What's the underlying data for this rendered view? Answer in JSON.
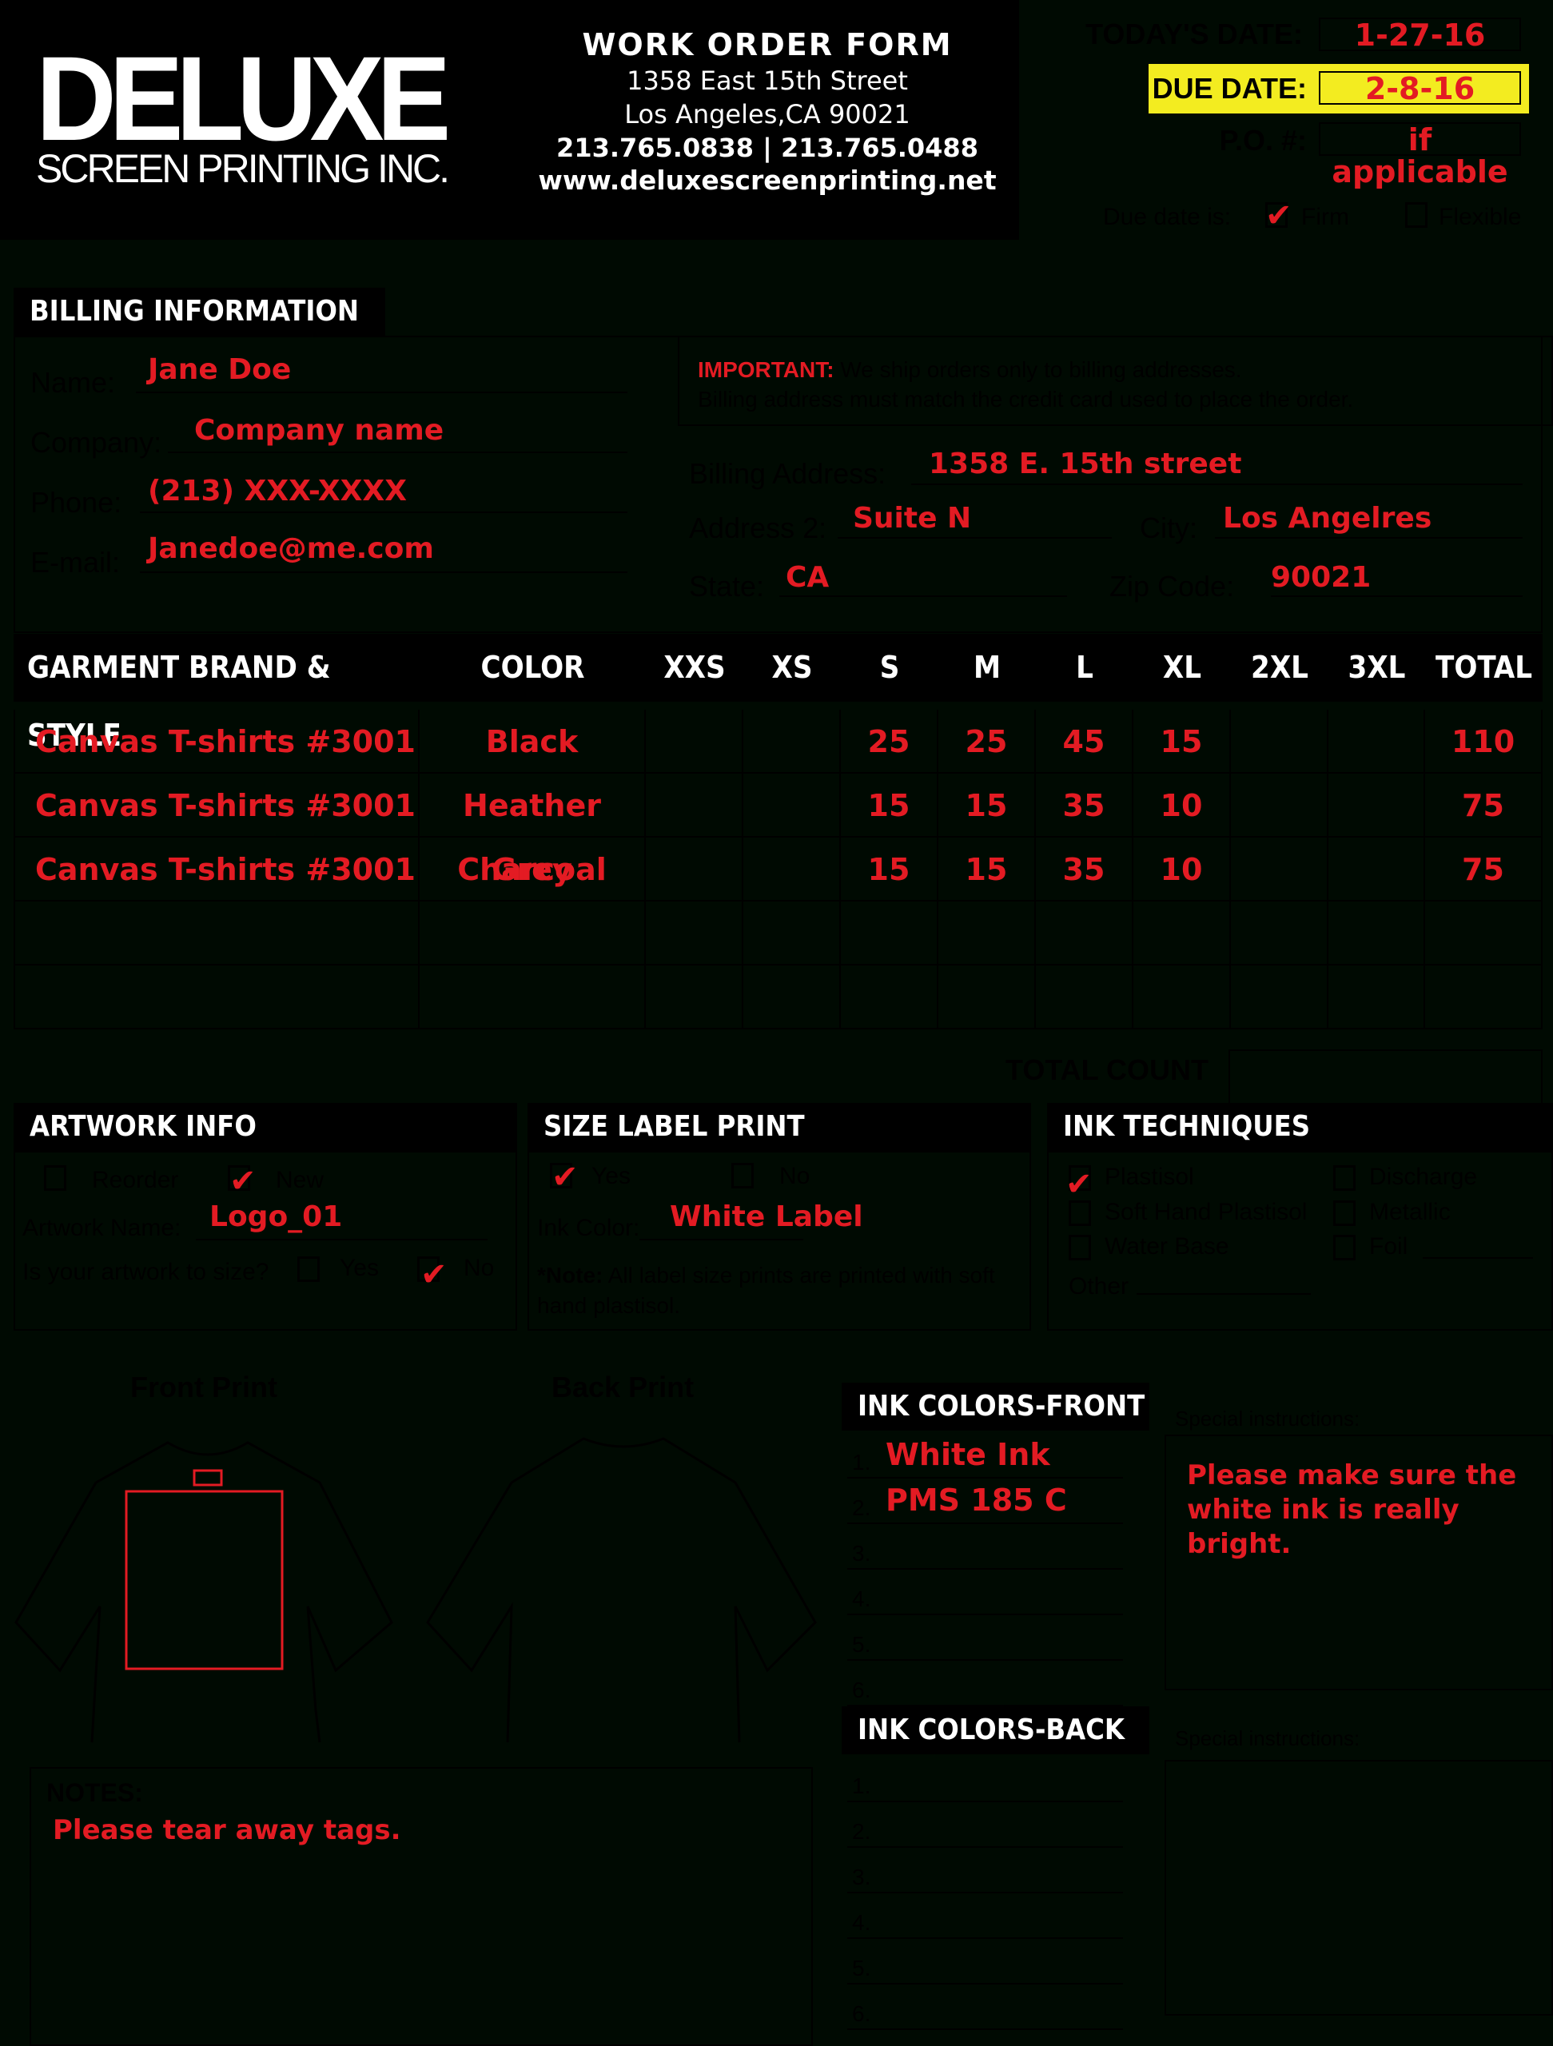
{
  "header": {
    "logo_main": "DELUXE",
    "logo_sub": "SCREEN PRINTING INC.",
    "form_title": "WORK ORDER FORM",
    "address_line1": "1358 East 15th Street",
    "address_line2": "Los Angeles,CA 90021",
    "phones": "213.765.0838 | 213.765.0488",
    "website": "www.deluxescreenprinting.net"
  },
  "dates": {
    "today_label": "TODAY'S DATE:",
    "today_value": "1-27-16",
    "due_label": "DUE DATE:",
    "due_value": "2-8-16",
    "po_label": "P.O. #:",
    "po_value": "if applicable",
    "due_is_label": "Due date is:",
    "firm_label": "Firm",
    "firm_checked": true,
    "flexible_label": "Flexible",
    "flexible_checked": false,
    "highlight_color": "#f3ec20"
  },
  "billing": {
    "title": "BILLING INFORMATION",
    "name_label": "Name:",
    "name_value": "Jane Doe",
    "company_label": "Company:",
    "company_value": "Company name",
    "phone_label": "Phone:",
    "phone_value": "(213) XXX-XXXX",
    "email_label": "E-mail:",
    "email_value": "Janedoe@me.com",
    "important_label": "IMPORTANT:",
    "important_line1": "We ship orders only to billing addresses.",
    "important_line2": "Billing address must match the credit card used to place the order.",
    "address_label": "Billing Address:",
    "address_value": "1358 E. 15th street",
    "address2_label": "Address 2:",
    "address2_value": "Suite N",
    "city_label": "City:",
    "city_value": "Los Angelres",
    "state_label": "State:",
    "state_value": "CA",
    "zip_label": "Zip Code:",
    "zip_value": "90021"
  },
  "garments": {
    "headers": [
      "GARMENT BRAND & STYLE",
      "COLOR",
      "XXS",
      "XS",
      "S",
      "M",
      "L",
      "XL",
      "2XL",
      "3XL",
      "TOTAL"
    ],
    "rows": [
      [
        "Canvas T-shirts #3001",
        "Black",
        "",
        "",
        "25",
        "25",
        "45",
        "15",
        "",
        "",
        "110"
      ],
      [
        "Canvas T-shirts #3001",
        "Heather Grey",
        "",
        "",
        "15",
        "15",
        "35",
        "10",
        "",
        "",
        "75"
      ],
      [
        "Canvas T-shirts #3001",
        "Charcoal",
        "",
        "",
        "15",
        "15",
        "35",
        "10",
        "",
        "",
        "75"
      ],
      [
        "",
        "",
        "",
        "",
        "",
        "",
        "",
        "",
        "",
        "",
        ""
      ],
      [
        "",
        "",
        "",
        "",
        "",
        "",
        "",
        "",
        "",
        "",
        ""
      ]
    ],
    "total_count_label": "TOTAL COUNT",
    "total_count_value": ""
  },
  "artwork": {
    "title": "ARTWORK INFO",
    "reorder_label": "Reorder",
    "reorder_checked": false,
    "new_label": "New",
    "new_checked": true,
    "name_label": "Artwork Name:",
    "name_value": "Logo_01",
    "to_size_label": "Is your artwork to size?",
    "yes_label": "Yes",
    "yes_checked": false,
    "no_label": "No",
    "no_checked": true
  },
  "size_label": {
    "title": "SIZE LABEL PRINT",
    "yes_label": "Yes",
    "yes_checked": true,
    "no_label": "No",
    "no_checked": false,
    "ink_color_label": "Ink Color:",
    "ink_color_value": "White Label",
    "note_bold": "*Note:",
    "note_text": "All label size prints are printed with soft hand plastisol."
  },
  "ink_techniques": {
    "title": "INK TECHNIQUES",
    "options": [
      {
        "label": "Plastisol",
        "checked": true
      },
      {
        "label": "Discharge",
        "checked": false
      },
      {
        "label": "Soft Hand Plastisol",
        "checked": false
      },
      {
        "label": "Metallic",
        "checked": false
      },
      {
        "label": "Water Base",
        "checked": false
      },
      {
        "label": "Foil",
        "checked": false
      }
    ],
    "other_label": "Other"
  },
  "prints": {
    "front_label": "Front Print",
    "back_label": "Back Print",
    "marker_color": "#e31b23"
  },
  "ink_front": {
    "title": "INK COLORS-FRONT",
    "numbers": [
      "1.",
      "2.",
      "3.",
      "4.",
      "5.",
      "6."
    ],
    "values": [
      "White Ink",
      "PMS 185 C",
      "",
      "",
      "",
      ""
    ],
    "special_label": "Special instructions:",
    "special_value": "Please make sure the white ink is really bright."
  },
  "ink_back": {
    "title": "INK COLORS-BACK",
    "numbers": [
      "1.",
      "2.",
      "3.",
      "4.",
      "5.",
      "6."
    ],
    "values": [
      "",
      "",
      "",
      "",
      "",
      ""
    ],
    "special_label": "Special instructions:",
    "special_value": ""
  },
  "notes": {
    "label": "NOTES:",
    "value": "Please tear away tags."
  }
}
